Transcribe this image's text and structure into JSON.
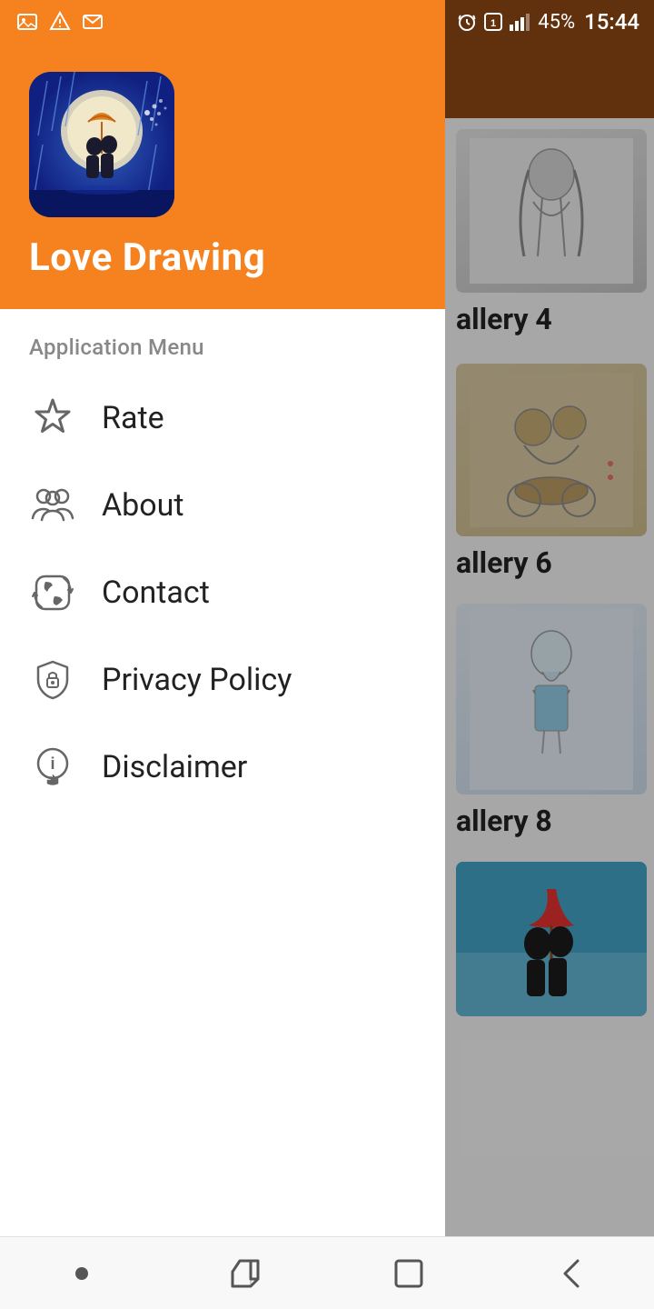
{
  "statusBar": {
    "leftIcons": [
      "image-icon",
      "alert-icon",
      "email-icon"
    ],
    "battery": "45%",
    "time": "15:44",
    "alarmIcon": true,
    "simIcon": true,
    "signalIcon": true
  },
  "app": {
    "title": "Love Drawing",
    "logoAlt": "Love Drawing App Icon"
  },
  "menu": {
    "sectionLabel": "Application Menu",
    "items": [
      {
        "id": "rate",
        "label": "Rate",
        "icon": "star-icon"
      },
      {
        "id": "about",
        "label": "About",
        "icon": "people-icon"
      },
      {
        "id": "contact",
        "label": "Contact",
        "icon": "phone-icon"
      },
      {
        "id": "privacy",
        "label": "Privacy Policy",
        "icon": "shield-icon"
      },
      {
        "id": "disclaimer",
        "label": "Disclaimer",
        "icon": "info-icon"
      }
    ]
  },
  "gallery": {
    "sections": [
      {
        "label": "allery 4"
      },
      {
        "label": "allery 6"
      },
      {
        "label": "allery 8"
      }
    ]
  },
  "bottomNav": {
    "items": [
      "dot-icon",
      "recent-icon",
      "home-icon",
      "back-icon"
    ]
  },
  "colors": {
    "orange": "#F5821F",
    "darkBrown": "#8B4513",
    "white": "#ffffff",
    "menuText": "#222222",
    "sectionText": "#888888"
  }
}
